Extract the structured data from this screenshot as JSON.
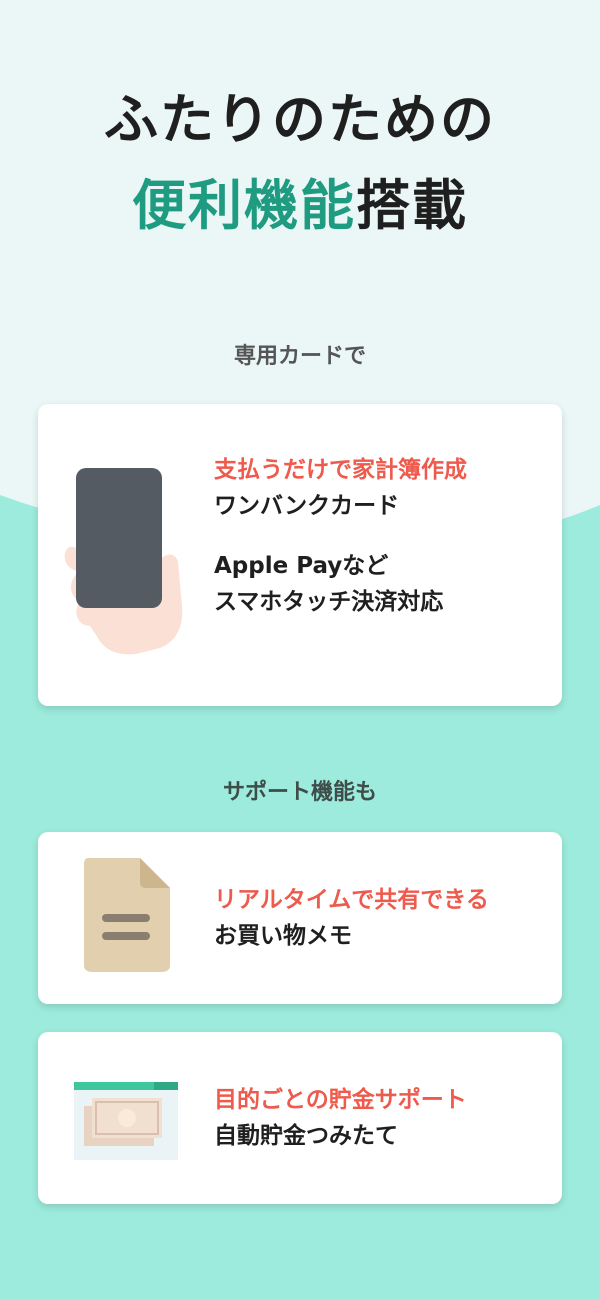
{
  "hero": {
    "line1": "ふたりのための",
    "line2_accent": "便利機能",
    "line2_dark": "搭載"
  },
  "sections": {
    "card_section_label": "専用カードで",
    "support_section_label": "サポート機能も"
  },
  "cards": [
    {
      "icon": "phone-payment-icon",
      "highlight": "支払うだけで家計簿作成",
      "title": "ワンバンクカード",
      "extra_line1": "Apple Payなど",
      "extra_line2": "スマホタッチ決済対応"
    },
    {
      "icon": "document-icon",
      "highlight": "リアルタイムで共有できる",
      "title": "お買い物メモ"
    },
    {
      "icon": "money-savings-icon",
      "highlight": "目的ごとの貯金サポート",
      "title": "自動貯金つみたて"
    }
  ],
  "colors": {
    "accent_green": "#1e9b80",
    "highlight_red": "#ee5a4c",
    "bg_light": "#eaf7f6",
    "bg_mint": "#9cebdc"
  }
}
